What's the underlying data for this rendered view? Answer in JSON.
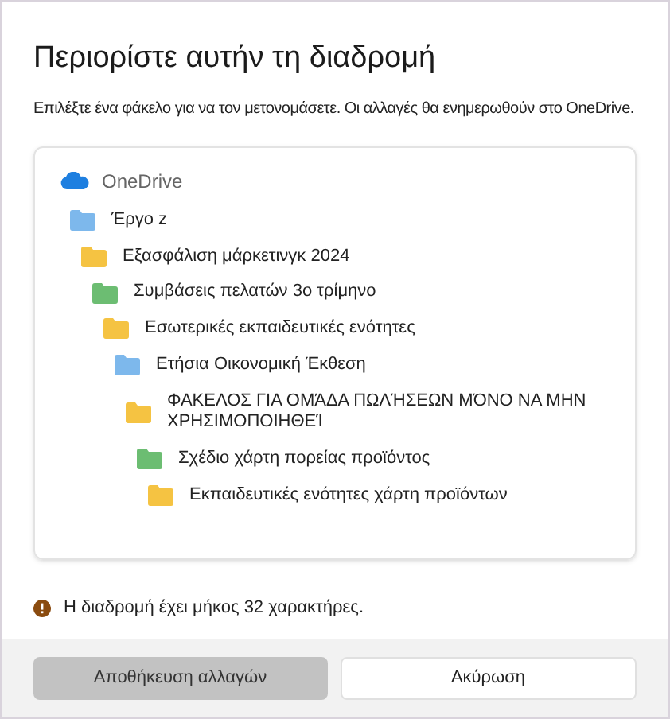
{
  "title": "Περιορίστε αυτήν τη διαδρομή",
  "subtitle": "Επιλέξτε ένα φάκελο για να τον μετονομάσετε.  Οι αλλαγές θα ενημερωθούν στο OneDrive.",
  "tree": {
    "root": "OneDrive",
    "children": [
      {
        "label": "Έργο z",
        "color": "#7db8ec",
        "children": [
          {
            "label": "Εξασφάλιση μάρκετινγκ 2024",
            "color": "#f5c342",
            "children": [
              {
                "label": "Συμβάσεις πελατών 3ο τρίμηνο",
                "color": "#6cbd72",
                "children": [
                  {
                    "label": "Εσωτερικές εκπαιδευτικές ενότητες",
                    "color": "#f5c342",
                    "children": [
                      {
                        "label": "Ετήσια Οικονομική Έκθεση",
                        "color": "#7db8ec",
                        "children": [
                          {
                            "label": "ΦΑΚΕΛΟΣ ΓΙΑ ΟΜΆΔΑ ΠΩΛΉΣΕΩΝ ΜΌΝΟ ΝΑ ΜΗΝ ΧΡΗΣΙΜΟΠΟΙΗΘΕΊ",
                            "color": "#f5c342",
                            "children": [
                              {
                                "label": "Σχέδιο χάρτη πορείας προϊόντος",
                                "color": "#6cbd72",
                                "children": [
                                  {
                                    "label": "Εκπαιδευτικές ενότητες χάρτη προϊόντων",
                                    "color": "#f5c342"
                                  }
                                ]
                              }
                            ]
                          }
                        ]
                      }
                    ]
                  }
                ]
              }
            ]
          }
        ]
      }
    ]
  },
  "warning": "Η διαδρομή έχει μήκος 32 χαρακτήρες.",
  "buttons": [
    {
      "label": "Αποθήκευση αλλαγών",
      "disabled": true
    },
    {
      "label": "Ακύρωση",
      "disabled": false
    }
  ]
}
